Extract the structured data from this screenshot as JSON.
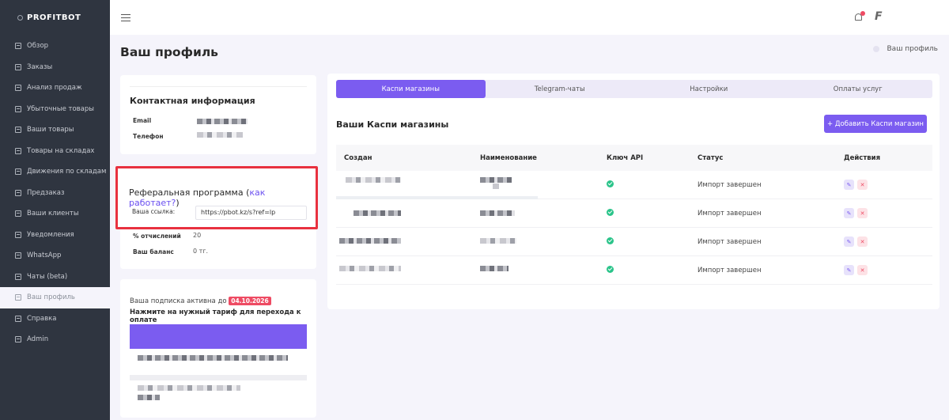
{
  "brand": {
    "name": "PROFITBOT"
  },
  "sidebar": {
    "items": [
      {
        "label": "Обзор",
        "icon": "calendar-icon"
      },
      {
        "label": "Заказы",
        "icon": "calendar-icon"
      },
      {
        "label": "Анализ продаж",
        "icon": "calendar-icon"
      },
      {
        "label": "Убыточные товары",
        "icon": "calendar-icon"
      },
      {
        "label": "Ваши товары",
        "icon": "calendar-icon"
      },
      {
        "label": "Товары на складах",
        "icon": "calendar-icon"
      },
      {
        "label": "Движения по складам",
        "icon": "calendar-icon"
      },
      {
        "label": "Предзаказ",
        "icon": "calendar-icon"
      },
      {
        "label": "Ваши клиенты",
        "icon": "calendar-icon"
      },
      {
        "label": "Уведомления",
        "icon": "calendar-icon"
      },
      {
        "label": "WhatsApp",
        "icon": "calendar-icon"
      },
      {
        "label": "Чаты (beta)",
        "icon": "calendar-icon"
      },
      {
        "label": "Ваш профиль",
        "icon": "calendar-icon",
        "active": true
      },
      {
        "label": "Справка",
        "icon": "document-icon"
      },
      {
        "label": "Admin",
        "icon": "document-icon"
      }
    ]
  },
  "header": {
    "title": "Ваш профиль",
    "breadcrumb": "Ваш профиль",
    "notification_count": "1"
  },
  "contact": {
    "title": "Контактная информация",
    "email_label": "Email",
    "phone_label": "Телефон"
  },
  "referral": {
    "title_prefix": "Реферальная программа (",
    "title_link": "как работает?",
    "title_suffix": ")",
    "link_label": "Ваша ссылка:",
    "link_value": "https://pbot.kz/s?ref=lp",
    "percent_label": "% отчислений",
    "percent_value": "20",
    "balance_label": "Ваш баланс",
    "balance_value": "0 тг."
  },
  "subscription": {
    "active_text": "Ваша подписка активна до",
    "date": "04.10.2026",
    "instruction": "Нажмите на нужный тариф для перехода к оплате"
  },
  "tabs": [
    {
      "label": "Каспи магазины",
      "active": true
    },
    {
      "label": "Telegram-чаты"
    },
    {
      "label": "Настройки"
    },
    {
      "label": "Оплаты услуг"
    }
  ],
  "stores": {
    "title": "Ваши Каспи магазины",
    "add_button": "+ Добавить Каспи магазин",
    "columns": {
      "created": "Создан",
      "name": "Наименование",
      "api_key": "Ключ API",
      "status": "Статус",
      "actions": "Действия"
    },
    "rows": [
      {
        "status": "Импорт завершен"
      },
      {
        "status": "Импорт завершен"
      },
      {
        "status": "Импорт завершен"
      },
      {
        "status": "Импорт завершен"
      }
    ]
  },
  "colors": {
    "accent": "#7b5cf0",
    "sidebar_bg": "#2f3540",
    "danger": "#ee4b63",
    "success": "#2bc48a",
    "highlight_border": "#e8313f"
  }
}
